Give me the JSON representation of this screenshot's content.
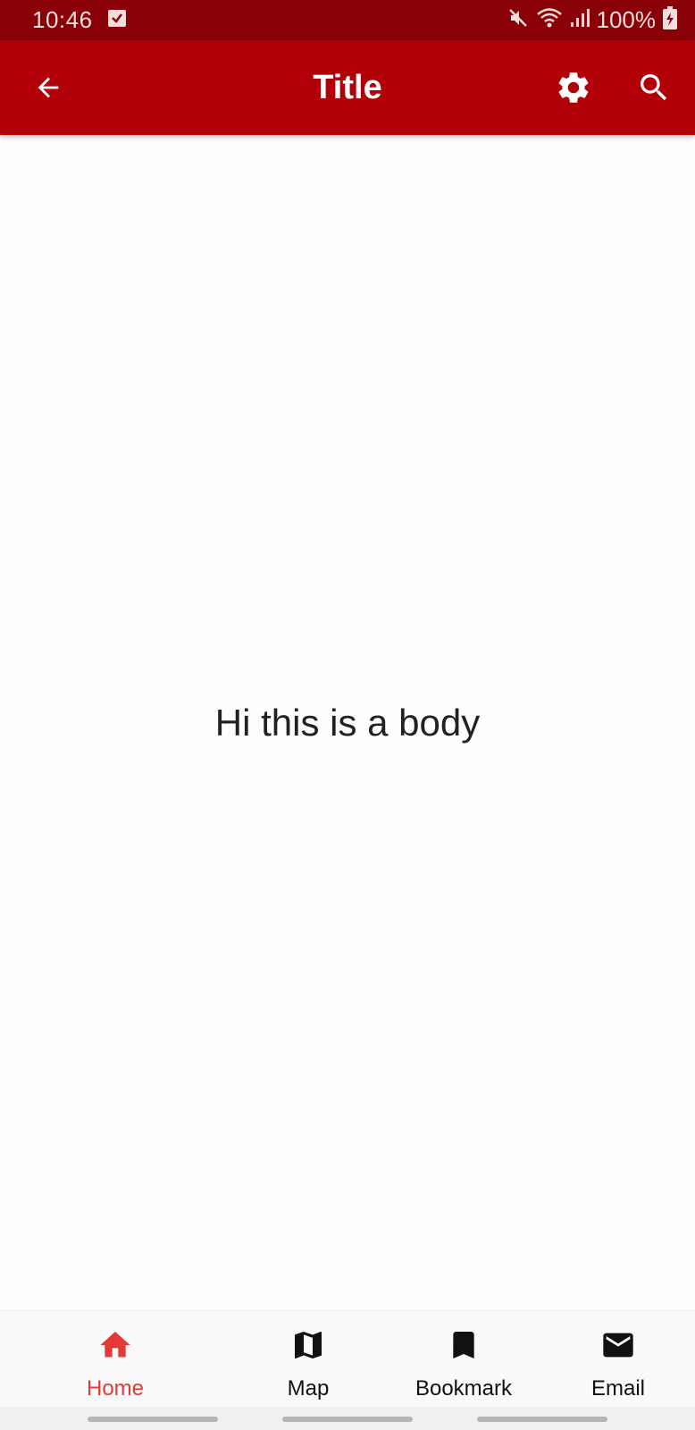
{
  "status_bar": {
    "time": "10:46",
    "battery_text": "100%",
    "icons": [
      "calendar-check-icon",
      "mute-icon",
      "wifi-icon",
      "signal-icon",
      "battery-charging-icon"
    ]
  },
  "app_bar": {
    "title": "Title",
    "icons": [
      "back-arrow-icon",
      "gear-icon",
      "search-icon"
    ]
  },
  "body": {
    "text": "Hi this is a body"
  },
  "bottom_nav": {
    "items": [
      {
        "label": "Home",
        "icon": "home-icon",
        "active": true
      },
      {
        "label": "Map",
        "icon": "map-icon",
        "active": false
      },
      {
        "label": "Bookmark",
        "icon": "bookmark-icon",
        "active": false
      },
      {
        "label": "Email",
        "icon": "email-icon",
        "active": false
      }
    ]
  },
  "colors": {
    "status_bar": "#8a0007",
    "app_bar": "#b20008",
    "active_nav": "#e53935",
    "body_background": "#fdfdfd"
  }
}
